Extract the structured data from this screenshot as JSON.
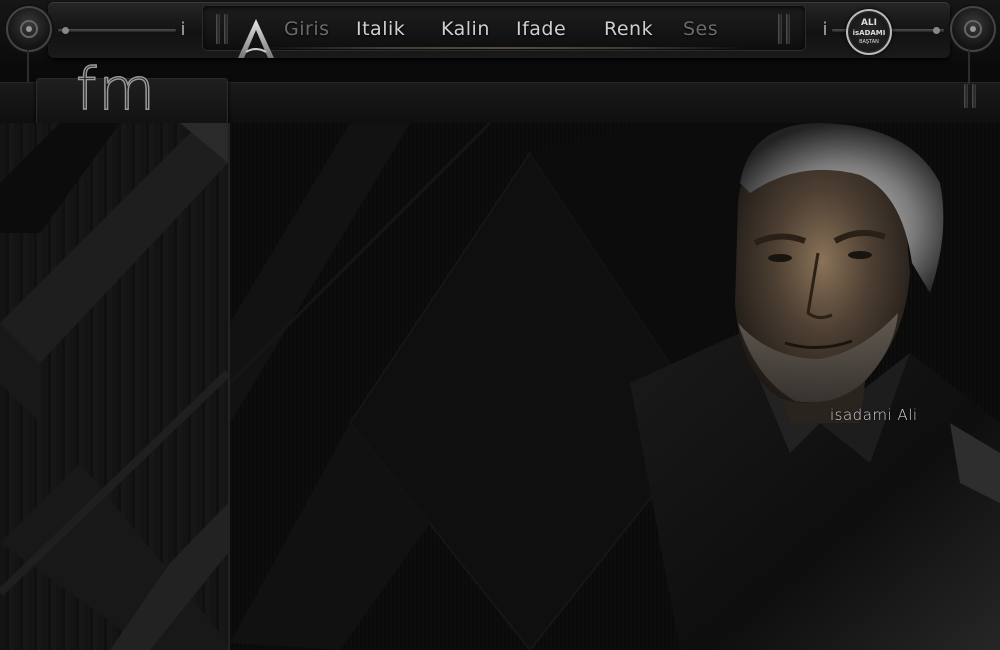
{
  "header": {
    "logo_letter": "A",
    "menu": [
      {
        "label": "Giris",
        "active": false
      },
      {
        "label": "Italik",
        "active": true
      },
      {
        "label": "Kalin",
        "active": true
      },
      {
        "label": "Ifade",
        "active": true
      },
      {
        "label": "Renk",
        "active": true
      },
      {
        "label": "Ses",
        "active": false
      }
    ],
    "badge": {
      "line1": "ALI",
      "line2": "isADAMI",
      "line3": "BAŞTAN"
    },
    "i_glyph": "i"
  },
  "section_tab": {
    "title": "fm"
  },
  "signature": "isadami Ali",
  "colors": {
    "background": "#0a0a0a",
    "text": "#cfcfcf",
    "accent": "#8a7560"
  }
}
